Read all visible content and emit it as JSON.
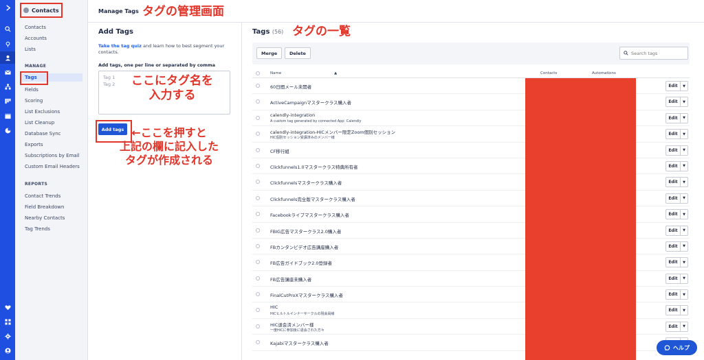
{
  "rail": {
    "logo": "logo-chevron-icon",
    "icons": [
      "search-icon",
      "location-pin-icon",
      "contacts-person-icon",
      "mail-icon",
      "automation-icon",
      "pipeline-icon",
      "site-icon",
      "report-icon"
    ],
    "bottom_icons": [
      "heart-icon",
      "apps-grid-icon",
      "settings-gear-icon",
      "profile-avatar-icon"
    ]
  },
  "sidebar": {
    "header": "Contacts",
    "links": [
      "Contacts",
      "Accounts",
      "Lists"
    ],
    "manage_title": "MANAGE",
    "manage_links": [
      "Tags",
      "Fields",
      "Scoring",
      "List Exclusions",
      "List Cleanup",
      "Database Sync",
      "Exports",
      "Subscriptions by Email",
      "Custom Email Headers"
    ],
    "reports_title": "REPORTS",
    "reports_links": [
      "Contact Trends",
      "Field Breakdown",
      "Nearby Contacts",
      "Tag Trends"
    ]
  },
  "topbar": {
    "title": "Manage Tags"
  },
  "add_panel": {
    "title": "Add Tags",
    "quiz_link": "Take the tag quiz",
    "quiz_text": " and learn how to best segment your contacts.",
    "field_label": "Add tags, one per line or separated by comma",
    "placeholder": "Tag 1\nTag 2",
    "button": "Add tags"
  },
  "list_panel": {
    "title": "Tags",
    "count": "(56)",
    "merge": "Merge",
    "delete": "Delete",
    "search_placeholder": "Search tags",
    "col_name": "Name",
    "col_contacts": "Contacts",
    "col_automations": "Automations",
    "edit": "Edit",
    "tags": [
      {
        "name": "60日間メール未開者",
        "desc": ""
      },
      {
        "name": "ActiveCampaignマスタークラス購入者",
        "desc": ""
      },
      {
        "name": "calendly-integration",
        "desc": "A custom tag generated by connected App: Calendly"
      },
      {
        "name": "calendly-integration-HICメンバー限定Zoom個別セッション",
        "desc": "HIC個別セッション受講済みのメンバー様"
      },
      {
        "name": "CF移行組",
        "desc": ""
      },
      {
        "name": "Clickfunnels1.0マスタークラス特典所有者",
        "desc": ""
      },
      {
        "name": "Clickfunnelsマスタークラス購入者",
        "desc": ""
      },
      {
        "name": "Clickfunnels完全版マスタークラス購入者",
        "desc": ""
      },
      {
        "name": "Facebookライブマスタークラス購入者",
        "desc": ""
      },
      {
        "name": "FBIG広告マスタークラス2.0購入者",
        "desc": ""
      },
      {
        "name": "FBカンタンビデオ広告講座購入者",
        "desc": ""
      },
      {
        "name": "FB広告ガイドブック2.0登録者",
        "desc": ""
      },
      {
        "name": "FB広告講座未購入者",
        "desc": ""
      },
      {
        "name": "FinalCutProXマスタークラス購入者",
        "desc": ""
      },
      {
        "name": "HIC",
        "desc": "HICヒルトルインナーサークルの現会員様"
      },
      {
        "name": "HIC退会済メンバー様",
        "desc": "一度HICに参加後に退会された方々"
      },
      {
        "name": "Kajabiマスタークラス購入者",
        "desc": ""
      }
    ]
  },
  "annotations": {
    "a1": "タグの管理画面",
    "a2": "タグの一覧",
    "a3": "ここにタグ名を\n入力する",
    "a4": "←ここを押すと\n上記の欄に記入した\nタグが作成される"
  },
  "help": "ヘルプ",
  "colors": {
    "accent": "#1f56d6",
    "annotation": "#e2352a",
    "redaction": "#e8402d"
  }
}
